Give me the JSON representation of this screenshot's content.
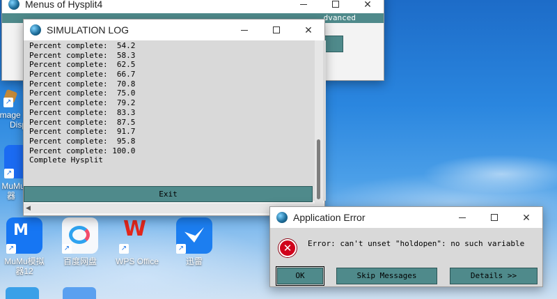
{
  "desktop": {
    "icons": [
      {
        "label1": "Image",
        "label2": "Disp"
      },
      {
        "label1": "MuMu",
        "label2": "器"
      },
      {
        "label1": "MuMu模拟",
        "label2": "器12"
      },
      {
        "label1": "百度网盘",
        "label2": ""
      },
      {
        "label1": "WPS Office",
        "label2": ""
      },
      {
        "label1": "迅雷",
        "label2": ""
      }
    ]
  },
  "menus_window": {
    "title": "Menus of Hysplit4",
    "menu_partial": "dvanced"
  },
  "log_window": {
    "title": "SIMULATION LOG",
    "lines": [
      "Percent complete:  54.2",
      "Percent complete:  58.3",
      "Percent complete:  62.5",
      "Percent complete:  66.7",
      "Percent complete:  70.8",
      "Percent complete:  75.0",
      "Percent complete:  79.2",
      "Percent complete:  83.3",
      "Percent complete:  87.5",
      "Percent complete:  91.7",
      "Percent complete:  95.8",
      "Percent complete: 100.0",
      "Complete Hysplit"
    ],
    "exit_label": "Exit"
  },
  "error_window": {
    "title": "Application Error",
    "message": "Error: can't unset \"holdopen\": no such variable",
    "ok_label": "OK",
    "skip_label": "Skip Messages",
    "details_label": "Details >>"
  },
  "colors": {
    "tk_teal": "#4f8a8b",
    "tk_gray": "#d9d9d9"
  }
}
